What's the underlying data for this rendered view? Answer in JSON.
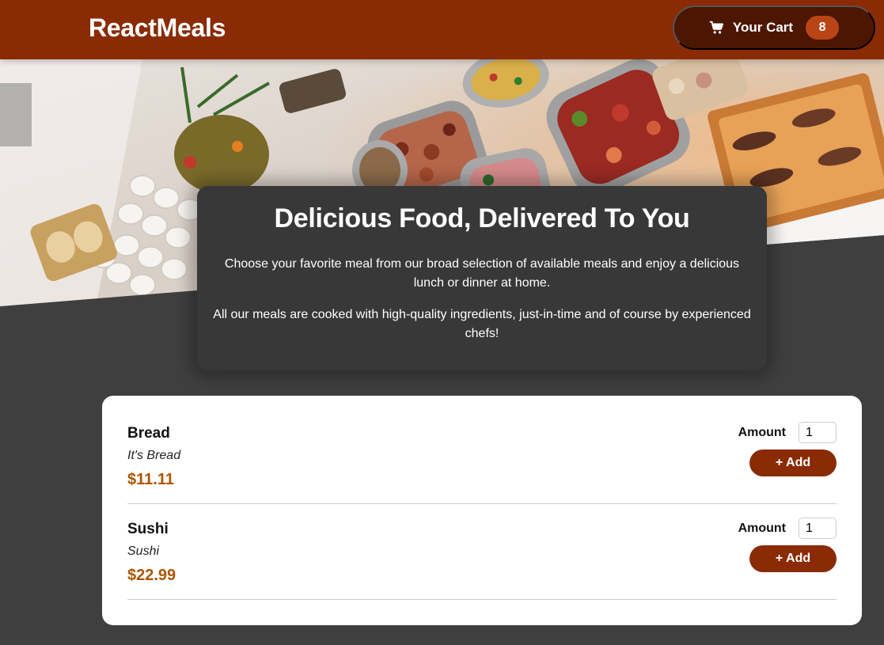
{
  "header": {
    "logo": "ReactMeals",
    "cart_label": "Your Cart",
    "cart_count": "8"
  },
  "summary": {
    "title": "Delicious Food, Delivered To You",
    "paragraph1": "Choose your favorite meal from our broad selection of available meals and enjoy a delicious lunch or dinner at home.",
    "paragraph2": "All our meals are cooked with high-quality ingredients, just-in-time and of course by experienced chefs!"
  },
  "meals": [
    {
      "name": "Bread",
      "description": "It's Bread",
      "price": "$11.11",
      "amount_label": "Amount",
      "amount": "1",
      "add_label": "+ Add"
    },
    {
      "name": "Sushi",
      "description": "Sushi",
      "price": "$22.99",
      "amount_label": "Amount",
      "amount": "1",
      "add_label": "+ Add"
    }
  ],
  "colors": {
    "header": "#8a2b06",
    "cart_button": "#4d1601",
    "badge": "#b94517",
    "page_background": "#3f3f3f",
    "summary_background": "#383838",
    "price": "#ad5502"
  },
  "icons": {
    "cart": "shopping-cart-icon"
  }
}
